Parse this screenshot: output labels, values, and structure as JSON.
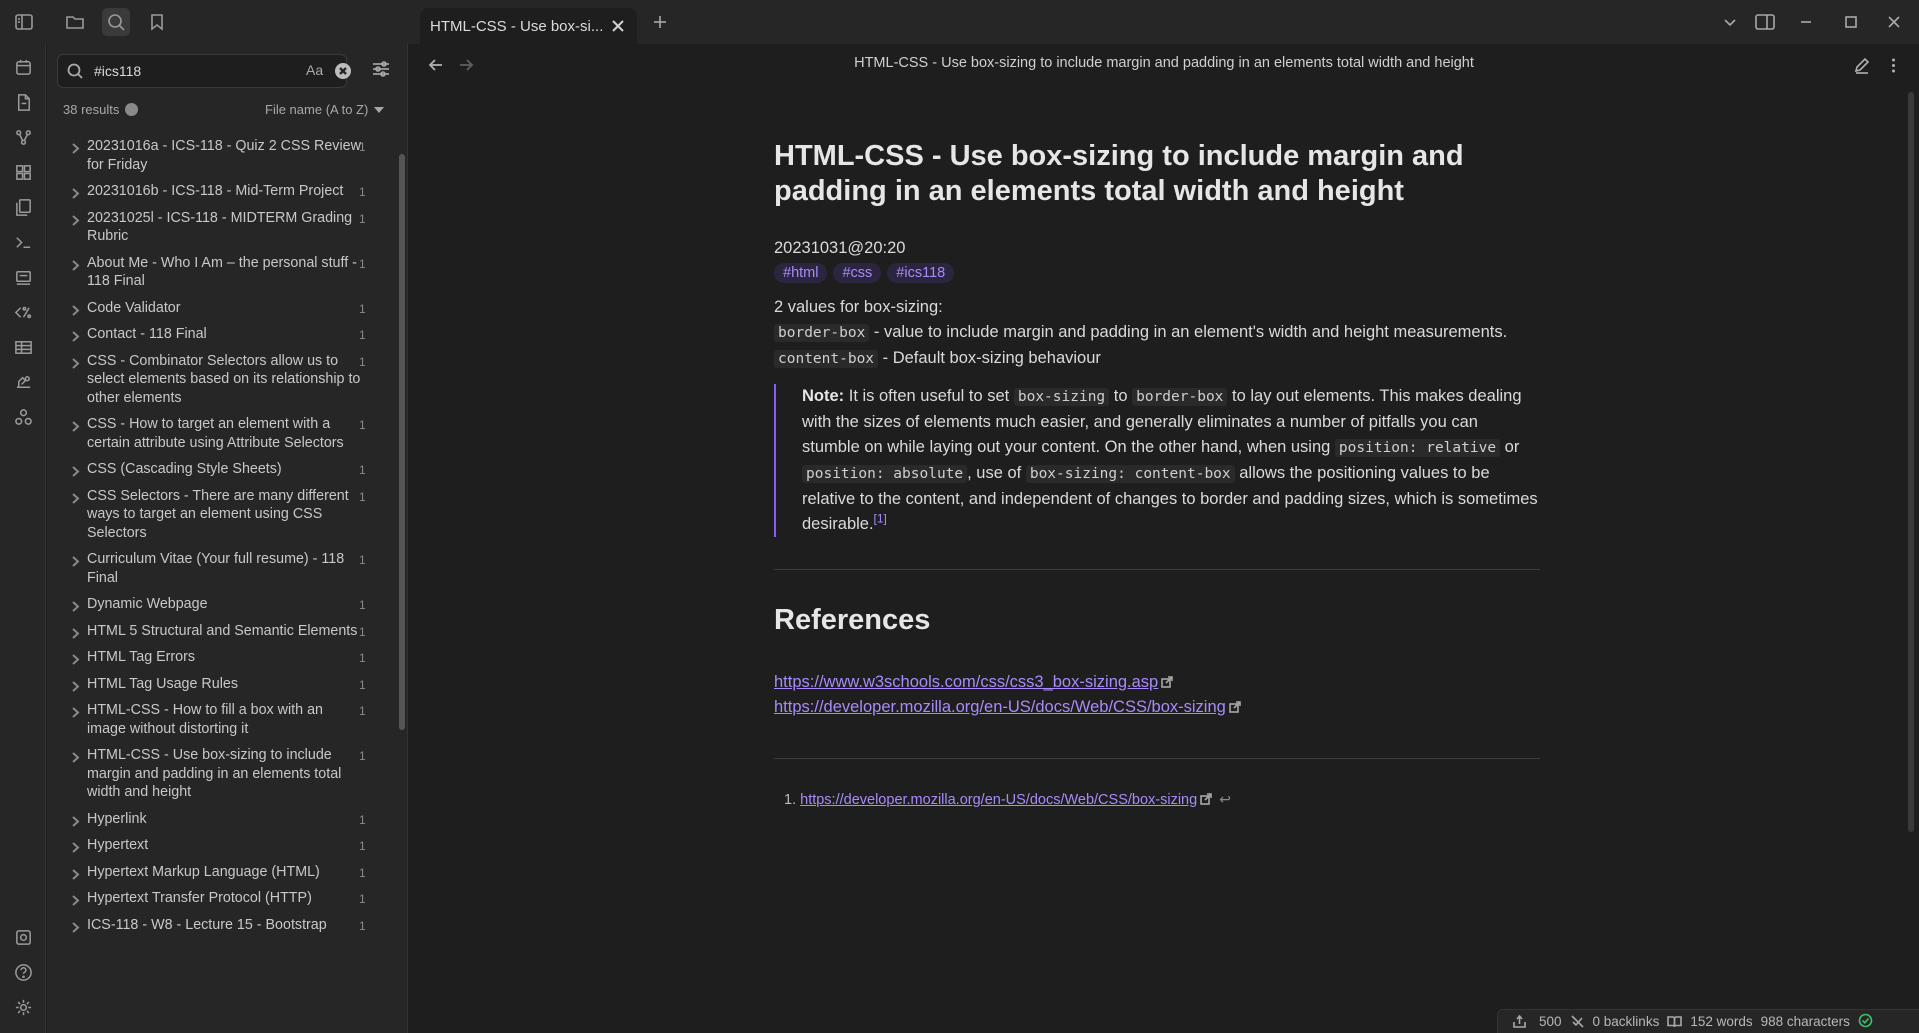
{
  "app": {
    "tab_title": "HTML-CSS - Use box-si...",
    "view_title": "HTML-CSS - Use box-sizing to include margin and padding in an elements total width and height"
  },
  "search": {
    "query": "#ics118",
    "match_case_label": "Aa",
    "results_count": "38 results",
    "sort_label": "File name (A to Z)"
  },
  "results": [
    {
      "title": "20231016a - ICS-118 - Quiz 2 CSS Review for Friday",
      "count": "1"
    },
    {
      "title": "20231016b - ICS-118 - Mid-Term Project",
      "count": "1"
    },
    {
      "title": "20231025l - ICS-118 - MIDTERM Grading Rubric",
      "count": "1"
    },
    {
      "title": "About Me - Who I Am – the personal stuff - 118 Final",
      "count": "1"
    },
    {
      "title": "Code Validator",
      "count": "1"
    },
    {
      "title": "Contact - 118 Final",
      "count": "1"
    },
    {
      "title": "CSS - Combinator Selectors allow us to select elements based on its relationship to other elements",
      "count": "1"
    },
    {
      "title": "CSS - How to target an element with a certain attribute using Attribute Selectors",
      "count": "1"
    },
    {
      "title": "CSS (Cascading Style Sheets)",
      "count": "1"
    },
    {
      "title": "CSS Selectors - There are many different ways to target an element using CSS Selectors",
      "count": "1"
    },
    {
      "title": "Curriculum Vitae (Your full resume) - 118 Final",
      "count": "1"
    },
    {
      "title": "Dynamic Webpage",
      "count": "1"
    },
    {
      "title": "HTML 5 Structural and Semantic Elements",
      "count": "1"
    },
    {
      "title": "HTML Tag Errors",
      "count": "1"
    },
    {
      "title": "HTML Tag Usage Rules",
      "count": "1"
    },
    {
      "title": "HTML-CSS - How to fill a box with an image without distorting it",
      "count": "1"
    },
    {
      "title": "HTML-CSS - Use box-sizing to include margin and padding in an elements total width and height",
      "count": "1"
    },
    {
      "title": "Hyperlink",
      "count": "1"
    },
    {
      "title": "Hypertext",
      "count": "1"
    },
    {
      "title": "Hypertext Markup Language (HTML)",
      "count": "1"
    },
    {
      "title": "Hypertext Transfer Protocol (HTTP)",
      "count": "1"
    },
    {
      "title": "ICS-118 - W8 - Lecture 15 - Bootstrap",
      "count": "1"
    }
  ],
  "note": {
    "title": "HTML-CSS - Use box-sizing to include margin and padding in an elements total width and height",
    "date": "20231031@20:20",
    "tags": [
      "#html",
      "#css",
      "#ics118"
    ],
    "intro": "2 values for box-sizing:",
    "border_box_code": "border-box",
    "border_box_desc": " - value to include margin and padding in an element's width and height measurements.",
    "content_box_code": "content-box",
    "content_box_desc": " - Default box-sizing behaviour",
    "quote": {
      "note_label": "Note:",
      "t1": " It is often useful to set ",
      "c1": "box-sizing",
      "t2": " to ",
      "c2": "border-box",
      "t3": " to lay out elements. This makes dealing with the sizes of elements much easier, and generally eliminates a number of pitfalls you can stumble on while laying out your content. On the other hand, when using ",
      "c3": "position: relative",
      "t4": " or ",
      "c4": "position: absolute",
      "t5": ", use of ",
      "c5": "box-sizing: content-box",
      "t6": " allows the positioning values to be relative to the content, and independent of changes to border and padding sizes, which is sometimes desirable.",
      "fnref": "[1]"
    },
    "references_heading": "References",
    "links": [
      "https://www.w3schools.com/css/css3_box-sizing.asp",
      "https://developer.mozilla.org/en-US/docs/Web/CSS/box-sizing"
    ],
    "footnote_number": "1.",
    "footnote_link": "https://developer.mozilla.org/en-US/docs/Web/CSS/box-sizing",
    "footnote_back": "↩"
  },
  "status": {
    "sync_count": "500",
    "backlinks": "0 backlinks",
    "words": "152 words",
    "characters": "988 characters"
  },
  "colors": {
    "accent": "#a88bfa",
    "background": "#1e1e1e",
    "sidebar": "#262626",
    "sync_ok": "#3fbf6a"
  }
}
